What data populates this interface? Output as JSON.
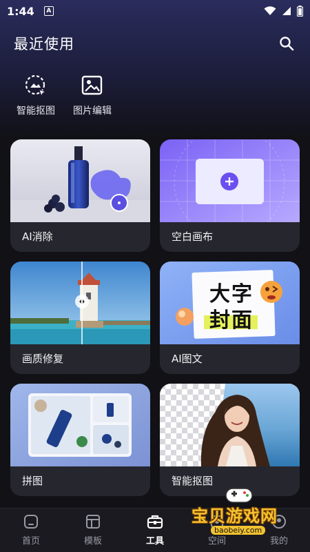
{
  "status_bar": {
    "time": "1:44",
    "notif_letter": "A"
  },
  "header": {
    "title": "最近使用"
  },
  "recent": [
    {
      "label": "智能抠图",
      "icon": "smart-cutout-icon"
    },
    {
      "label": "图片编辑",
      "icon": "image-edit-icon"
    }
  ],
  "tools": [
    {
      "label": "AI消除",
      "icon": "ai-erase"
    },
    {
      "label": "空白画布",
      "icon": "blank-canvas"
    },
    {
      "label": "画质修复",
      "icon": "quality-repair"
    },
    {
      "label": "AI图文",
      "icon": "ai-text-image"
    },
    {
      "label": "拼图",
      "icon": "collage"
    },
    {
      "label": "智能抠图",
      "icon": "smart-cutout"
    }
  ],
  "banner": {
    "line1": "大字",
    "line2": "封面"
  },
  "nav": [
    {
      "label": "首页",
      "icon": "home-icon",
      "active": false
    },
    {
      "label": "模板",
      "icon": "template-icon",
      "active": false
    },
    {
      "label": "工具",
      "icon": "toolbox-icon",
      "active": true
    },
    {
      "label": "空间",
      "icon": "space-icon",
      "active": false
    },
    {
      "label": "我的",
      "icon": "profile-icon",
      "active": false
    }
  ],
  "watermark": {
    "text": "宝贝游戏网",
    "url": "baobeiy.com"
  },
  "colors": {
    "accent": "#6b4ff0",
    "background": "#111116",
    "card": "#26262e"
  }
}
